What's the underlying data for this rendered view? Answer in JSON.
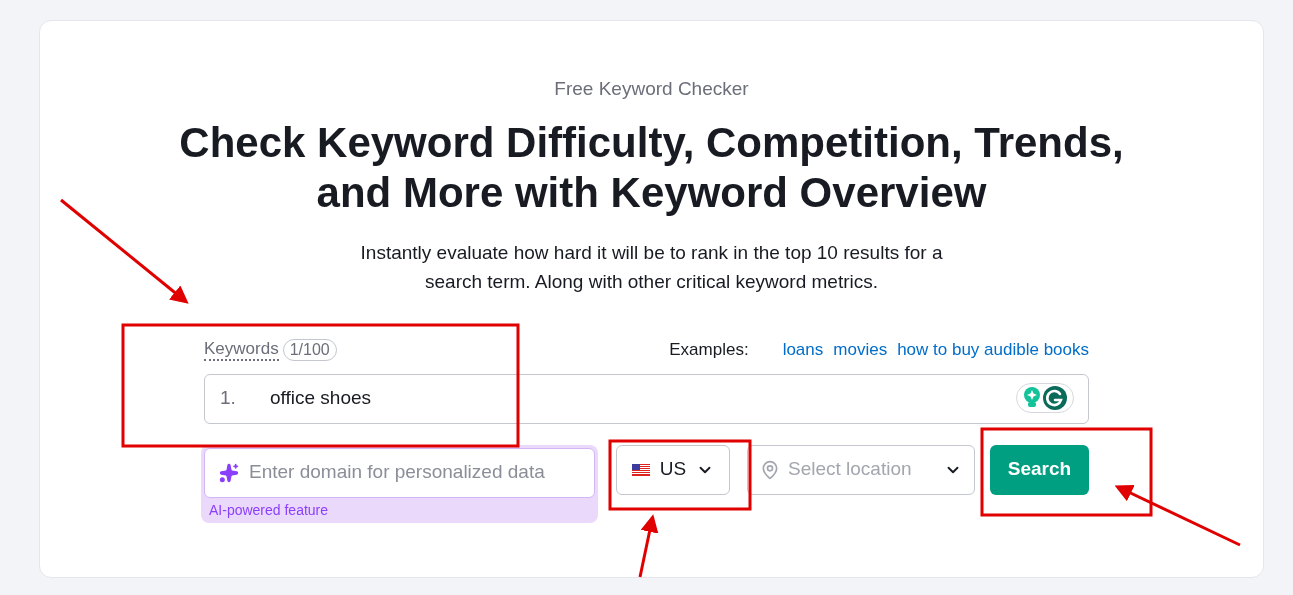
{
  "eyebrow": "Free Keyword Checker",
  "heading": [
    "Check Keyword Difficulty, Competition, Trends,",
    "and More with Keyword Overview"
  ],
  "description": [
    "Instantly evaluate how hard it will be to rank in the top 10 results for a",
    "search term. Along with other critical keyword metrics."
  ],
  "keywords": {
    "label": "Keywords",
    "count": "1/100",
    "examples_label": "Examples:",
    "examples": [
      "loans",
      "movies",
      "how to buy audible books"
    ],
    "lines": [
      {
        "number": "1.",
        "value": "office shoes"
      }
    ]
  },
  "domain": {
    "placeholder": "Enter domain for personalized data",
    "note": "AI-powered feature"
  },
  "country": {
    "code": "US"
  },
  "location": {
    "placeholder": "Select location"
  },
  "search_button": "Search"
}
